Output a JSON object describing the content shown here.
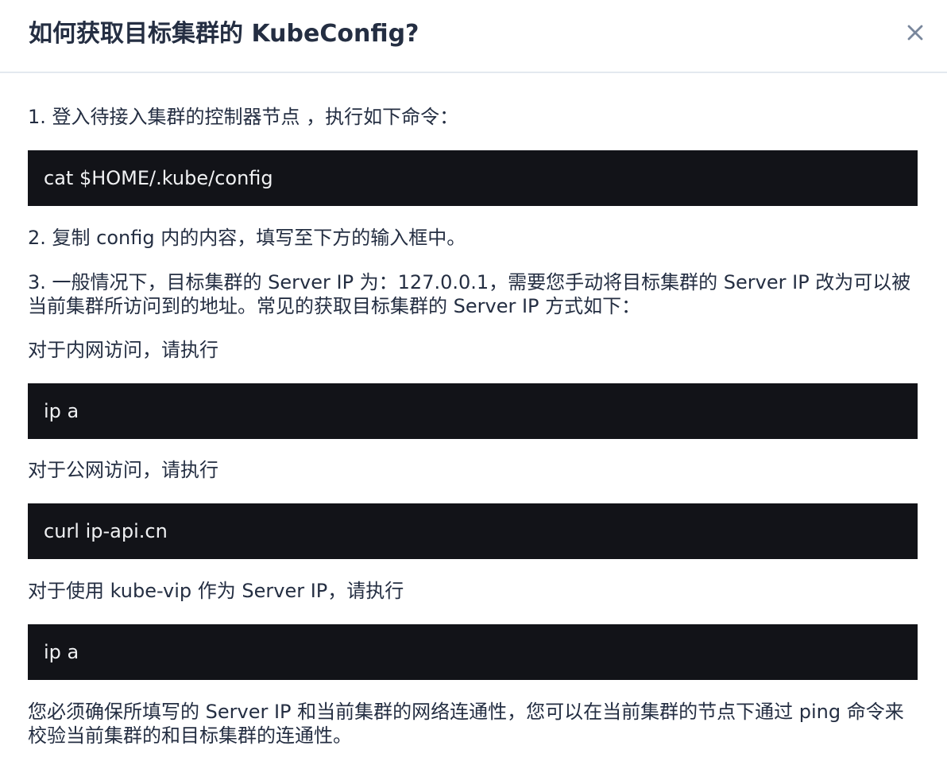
{
  "dialog": {
    "title": "如何获取目标集群的 KubeConfig?",
    "close_label": "×"
  },
  "content": {
    "step1": "1. 登入待接入集群的控制器节点 ，执行如下命令：",
    "cmd_config": "cat $HOME/.kube/config",
    "step2": "2. 复制 config 内的内容，填写至下方的输入框中。",
    "step3": "3. 一般情况下，目标集群的 Server IP 为：127.0.0.1，需要您手动将目标集群的 Server IP 改为可以被当前集群所访问到的地址。常见的获取目标集群的 Server IP 方式如下：",
    "intranet_label": "对于内网访问，请执行",
    "cmd_intranet": "ip a",
    "public_label": "对于公网访问，请执行",
    "cmd_public": "curl ip-api.cn",
    "kubevip_label": "对于使用 kube-vip 作为 Server IP，请执行",
    "cmd_kubevip": "ip a",
    "note": "您必须确保所填写的 Server IP 和当前集群的网络连通性，您可以在当前集群的节点下通过 ping 命令来校验当前集群的和目标集群的连通性。"
  },
  "colors": {
    "code_background": "#121318",
    "code_text": "#f0f1f3",
    "text": "#242e42",
    "divider": "#e3e9ef"
  }
}
